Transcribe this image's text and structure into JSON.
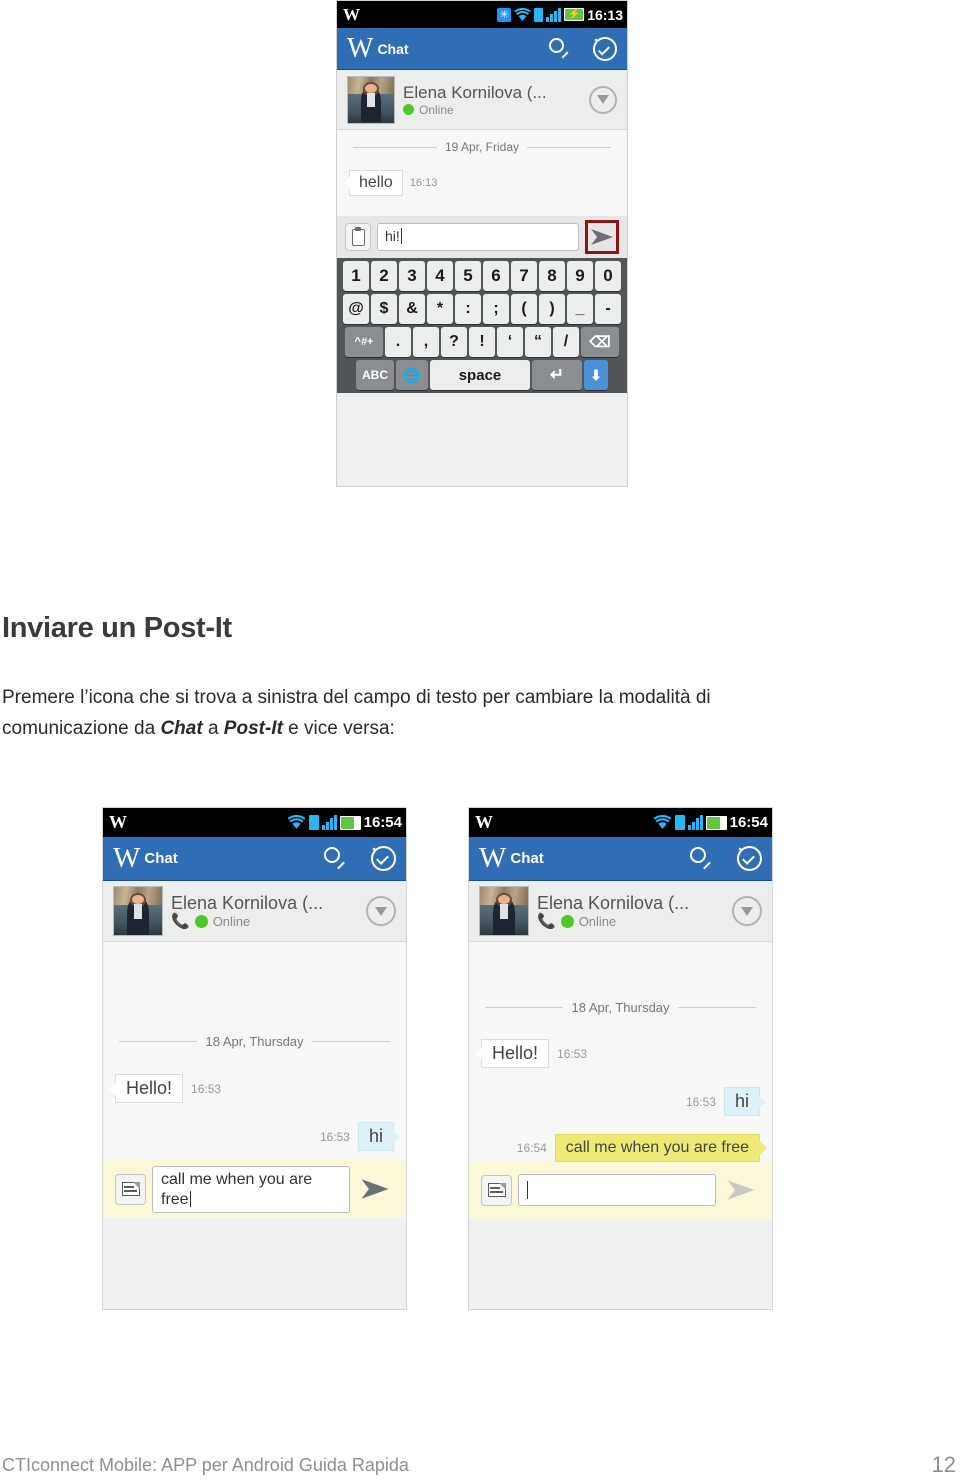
{
  "document": {
    "heading": "Inviare un Post-It",
    "paragraph_line1": "Premere l’icona che si trova a sinistra del campo di testo per cambiare la modalità di",
    "paragraph_line2_a": "comunicazione da ",
    "paragraph_line2_bold1": "Chat",
    "paragraph_line2_b": " a ",
    "paragraph_line2_bold2": "Post-It",
    "paragraph_line2_c": " e vice versa:",
    "footer_text": "CTIconnect Mobile: APP per Android Guida Rapida",
    "page_number": "12"
  },
  "colors": {
    "appbar_blue": "#2f6db5",
    "status_black": "#000000",
    "online_green": "#4fc72a",
    "postit_yellow": "#eeea78",
    "outgoing_blue": "#dff0f7",
    "highlight_red": "#8c1414",
    "composer_gray": "#e6e6e6",
    "composer_postit": "#fbf7d9"
  },
  "screenshot_top": {
    "statusbar": {
      "logo": "W",
      "time": "16:13",
      "icons": [
        "bluetooth-icon",
        "wifi-icon",
        "vibrate-icon",
        "signal-icon",
        "battery-charging-icon"
      ]
    },
    "appbar": {
      "logo": "W",
      "title": "Chat",
      "icons": [
        "search-icon",
        "check-circle-icon"
      ]
    },
    "contact": {
      "name": "Elena Kornilova (...",
      "status": "Online",
      "expander": "chevron-down-icon"
    },
    "chat": {
      "date_separator": "19 Apr, Friday",
      "messages": [
        {
          "direction": "in",
          "text": "hello",
          "time": "16:13",
          "type": "chat"
        }
      ]
    },
    "composer": {
      "mode": "chat",
      "left_icon": "clipboard-note-icon",
      "value": "hi!",
      "placeholder": "",
      "send_icon": "send-arrow-icon",
      "send_highlighted": true
    },
    "keyboard": {
      "row1": [
        "1",
        "2",
        "3",
        "4",
        "5",
        "6",
        "7",
        "8",
        "9",
        "0"
      ],
      "row2": [
        "@",
        "$",
        "&",
        "*",
        ":",
        ";",
        "(",
        ")",
        "_",
        "-"
      ],
      "row3": [
        "^#+",
        ".",
        ",",
        "?",
        "!",
        "‘",
        "“",
        "/",
        "⌫"
      ],
      "row4": [
        "ABC",
        "🌐",
        "space",
        "↵",
        "⬇"
      ]
    }
  },
  "screenshot_left": {
    "statusbar": {
      "logo": "W",
      "time": "16:54",
      "icons": [
        "wifi-icon",
        "vibrate-icon",
        "signal-icon",
        "battery-icon"
      ]
    },
    "appbar": {
      "logo": "W",
      "title": "Chat",
      "icons": [
        "search-icon",
        "check-circle-icon"
      ]
    },
    "contact": {
      "name": "Elena Kornilova (...",
      "status": "Online",
      "call_icon": "call-icon",
      "expander": "chevron-down-icon"
    },
    "chat": {
      "date_separator": "18 Apr, Thursday",
      "messages": [
        {
          "direction": "in",
          "text": "Hello!",
          "time": "16:53",
          "type": "chat"
        },
        {
          "direction": "out",
          "text": "hi",
          "time": "16:53",
          "type": "chat"
        }
      ]
    },
    "composer": {
      "mode": "postit",
      "left_icon": "postit-note-icon",
      "value": "call me when you are free",
      "placeholder": "",
      "send_icon": "send-arrow-icon",
      "send_highlighted": false
    }
  },
  "screenshot_right": {
    "statusbar": {
      "logo": "W",
      "time": "16:54",
      "icons": [
        "wifi-icon",
        "vibrate-icon",
        "signal-icon",
        "battery-icon"
      ]
    },
    "appbar": {
      "logo": "W",
      "title": "Chat",
      "icons": [
        "search-icon",
        "check-circle-icon"
      ]
    },
    "contact": {
      "name": "Elena Kornilova (...",
      "status": "Online",
      "call_icon": "call-icon",
      "expander": "chevron-down-icon"
    },
    "chat": {
      "date_separator": "18 Apr, Thursday",
      "messages": [
        {
          "direction": "in",
          "text": "Hello!",
          "time": "16:53",
          "type": "chat"
        },
        {
          "direction": "out",
          "text": "hi",
          "time": "16:53",
          "type": "chat"
        },
        {
          "direction": "out",
          "text": "call me when you are free",
          "time": "16:54",
          "type": "postit"
        }
      ]
    },
    "composer": {
      "mode": "postit",
      "left_icon": "postit-note-icon",
      "value": "",
      "placeholder": "",
      "send_icon": "send-arrow-icon",
      "send_highlighted": false
    }
  }
}
